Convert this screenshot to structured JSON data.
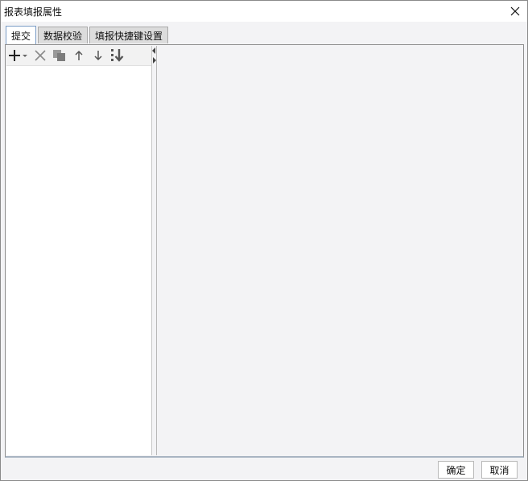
{
  "window": {
    "title": "报表填报属性"
  },
  "tabs": [
    {
      "label": "提交",
      "active": true
    },
    {
      "label": "数据校验",
      "active": false
    },
    {
      "label": "填报快捷键设置",
      "active": false
    }
  ],
  "toolbar": {
    "icons": [
      "add-icon",
      "dropdown-arrow-icon",
      "delete-icon",
      "copy-icon",
      "move-up-icon",
      "move-down-icon",
      "move-to-bottom-icon"
    ]
  },
  "buttons": {
    "ok": "确定",
    "cancel": "取消"
  },
  "colors": {
    "active_tab_border": "#7a9cc6",
    "background": "#f3f3f5"
  }
}
